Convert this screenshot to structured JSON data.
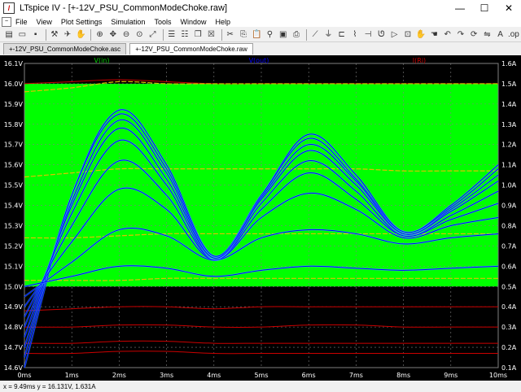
{
  "window": {
    "title": "LTspice IV - [+-12V_PSU_CommonModeChoke.raw]",
    "minimize": "—",
    "maximize": "☐",
    "close": "✕"
  },
  "menu": {
    "items": [
      "File",
      "View",
      "Plot Settings",
      "Simulation",
      "Tools",
      "Window",
      "Help"
    ]
  },
  "tabs": [
    {
      "label": "+-12V_PSU_CommonModeChoke.asc",
      "active": false
    },
    {
      "label": "+-12V_PSU_CommonModeChoke.raw",
      "active": true
    }
  ],
  "status": {
    "text": "x = 9.49ms   y = 16.131V, 1.631A"
  },
  "colors": {
    "plot_bg": "#000000",
    "highlight": "#00ff00",
    "vin": "#00cc00",
    "vout": "#0000ff",
    "iri": "#cc0000"
  },
  "chart_data": {
    "type": "line",
    "traces": [
      {
        "name": "V(in)",
        "color": "#00cc00"
      },
      {
        "name": "V(out)",
        "color": "#0000ff"
      },
      {
        "name": "I(Ri)",
        "color": "#cc0000"
      }
    ],
    "x_ticks": [
      "0ms",
      "1ms",
      "2ms",
      "3ms",
      "4ms",
      "5ms",
      "6ms",
      "7ms",
      "8ms",
      "9ms",
      "10ms"
    ],
    "xlim": [
      0,
      10
    ],
    "y_left_ticks": [
      "16.1V",
      "16.0V",
      "15.9V",
      "15.8V",
      "15.7V",
      "15.6V",
      "15.5V",
      "15.4V",
      "15.3V",
      "15.2V",
      "15.1V",
      "15.0V",
      "14.9V",
      "14.8V",
      "14.7V",
      "14.6V"
    ],
    "ylim_left": [
      14.6,
      16.1
    ],
    "y_right_ticks": [
      "1.6A",
      "1.5A",
      "1.4A",
      "1.3A",
      "1.2A",
      "1.1A",
      "1.0A",
      "0.9A",
      "0.8A",
      "0.7A",
      "0.6A",
      "0.5A",
      "0.4A",
      "0.3A",
      "0.2A",
      "0.1A"
    ],
    "ylim_right": [
      0.1,
      1.6
    ],
    "grid": true,
    "highlight_band": [
      15.0,
      16.0
    ],
    "vout_series": [
      {
        "values": [
          14.6,
          15.45,
          15.87,
          15.6,
          15.15,
          15.45,
          15.75,
          15.55,
          15.27,
          15.4,
          15.6
        ]
      },
      {
        "values": [
          14.65,
          15.45,
          15.85,
          15.58,
          15.15,
          15.45,
          15.73,
          15.53,
          15.27,
          15.39,
          15.58
        ]
      },
      {
        "values": [
          14.7,
          15.42,
          15.82,
          15.56,
          15.14,
          15.44,
          15.7,
          15.52,
          15.26,
          15.38,
          15.55
        ]
      },
      {
        "values": [
          14.75,
          15.4,
          15.78,
          15.53,
          15.14,
          15.43,
          15.67,
          15.5,
          15.26,
          15.37,
          15.52
        ]
      },
      {
        "values": [
          14.8,
          15.36,
          15.72,
          15.5,
          15.13,
          15.41,
          15.62,
          15.47,
          15.25,
          15.35,
          15.47
        ]
      },
      {
        "values": [
          14.85,
          15.3,
          15.62,
          15.45,
          15.13,
          15.38,
          15.56,
          15.43,
          15.25,
          15.33,
          15.41
        ]
      },
      {
        "values": [
          14.9,
          15.22,
          15.48,
          15.38,
          15.13,
          15.34,
          15.46,
          15.38,
          15.24,
          15.3,
          15.34
        ]
      },
      {
        "values": [
          14.95,
          15.12,
          15.28,
          15.25,
          15.13,
          15.24,
          15.28,
          15.26,
          15.21,
          15.24,
          15.26
        ]
      },
      {
        "values": [
          15.0,
          15.05,
          15.1,
          15.09,
          15.05,
          15.08,
          15.1,
          15.09,
          15.08,
          15.09,
          15.1
        ]
      }
    ],
    "vin_series": [
      {
        "values": [
          15.96,
          15.98,
          16.01,
          16.0,
          16.0,
          16.0,
          16.0,
          16.0,
          16.0,
          16.0,
          16.0
        ]
      },
      {
        "values": [
          15.54,
          15.56,
          15.58,
          15.58,
          15.58,
          15.58,
          15.58,
          15.58,
          15.57,
          15.57,
          15.57
        ]
      },
      {
        "values": [
          15.24,
          15.24,
          15.25,
          15.26,
          15.26,
          15.26,
          15.26,
          15.26,
          15.26,
          15.26,
          15.26
        ]
      },
      {
        "values": [
          15.03,
          15.03,
          15.03,
          15.04,
          15.04,
          15.04,
          15.04,
          15.04,
          15.04,
          15.04,
          15.04
        ]
      }
    ],
    "iri_series": [
      {
        "values": [
          1.5,
          1.51,
          1.52,
          1.51,
          1.5,
          1.5,
          1.5,
          1.5,
          1.5,
          1.5,
          1.5
        ]
      },
      {
        "values": [
          0.38,
          0.39,
          0.4,
          0.4,
          0.39,
          0.4,
          0.4,
          0.4,
          0.4,
          0.4,
          0.4
        ]
      },
      {
        "values": [
          0.3,
          0.3,
          0.31,
          0.31,
          0.3,
          0.3,
          0.31,
          0.31,
          0.3,
          0.3,
          0.3
        ]
      },
      {
        "values": [
          0.22,
          0.22,
          0.23,
          0.23,
          0.22,
          0.22,
          0.22,
          0.22,
          0.22,
          0.22,
          0.22
        ]
      },
      {
        "values": [
          0.17,
          0.17,
          0.18,
          0.18,
          0.17,
          0.17,
          0.17,
          0.17,
          0.17,
          0.17,
          0.17
        ]
      }
    ]
  }
}
